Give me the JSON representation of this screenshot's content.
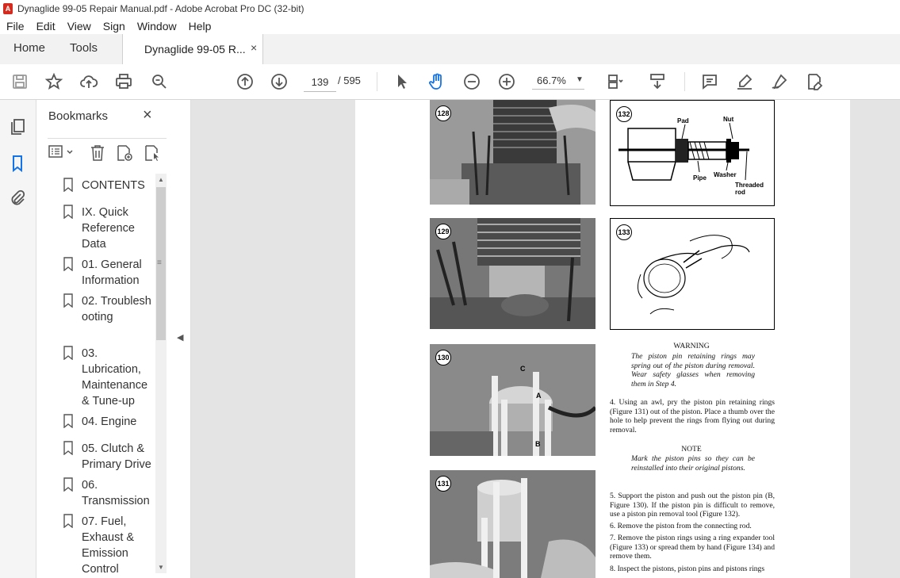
{
  "window": {
    "title": "Dynaglide 99-05 Repair Manual.pdf - Adobe Acrobat Pro DC (32-bit)",
    "app_icon_label": "A"
  },
  "menu": [
    "File",
    "Edit",
    "View",
    "Sign",
    "Window",
    "Help"
  ],
  "tabs": {
    "home": "Home",
    "tools": "Tools",
    "document": "Dynaglide 99-05 R...",
    "close": "×"
  },
  "toolbar": {
    "page_current": "139",
    "page_total": "/ 595",
    "zoom": "66.7%",
    "icons": [
      "save-icon",
      "bookmark-star-icon",
      "upload-icon",
      "print-icon",
      "search-zoom-icon",
      "page-up-icon",
      "page-down-icon",
      "select-cursor-icon",
      "hand-icon",
      "zoom-out-icon",
      "zoom-in-icon",
      "page-layout-icon",
      "scroll-mode-icon",
      "comment-icon",
      "highlight-icon",
      "sign-icon",
      "edit-pdf-icon"
    ]
  },
  "bookmarks": {
    "title": "Bookmarks",
    "close": "×",
    "items": [
      {
        "label": "CONTENTS"
      },
      {
        "label": "IX. Quick Reference Data"
      },
      {
        "label": "01. General Information"
      },
      {
        "label": "02. Troubleshooting"
      },
      {
        "label": "03. Lubrication, Maintenance & Tune-up"
      },
      {
        "label": "04. Engine"
      },
      {
        "label": "05. Clutch & Primary Drive"
      },
      {
        "label": "06. Transmission"
      },
      {
        "label": "07. Fuel, Exhaust & Emission Control"
      }
    ]
  },
  "page": {
    "figures": {
      "f128": "128",
      "f129": "129",
      "f130": "130",
      "f131": "131",
      "f132": "132",
      "f133": "133"
    },
    "fig132_labels": {
      "pad": "Pad",
      "nut": "Nut",
      "pipe": "Pipe",
      "washer": "Washer",
      "threaded_rod": "Threaded rod"
    },
    "fig130_labels": {
      "a": "A",
      "b": "B",
      "c": "C"
    },
    "warning_title": "WARNING",
    "warning_text": "The piston pin retaining rings may spring out of the piston during removal. Wear safety glasses when removing them in Step 4.",
    "step4": "4. Using an awl, pry the piston pin retaining rings (Figure 131) out of the piston. Place a thumb over the hole to help prevent the rings from flying out during removal.",
    "note_title": "NOTE",
    "note_text": "Mark the piston pins so they can be reinstalled into their original pistons.",
    "step5": "5. Support the piston and push out the piston pin (B, Figure 130). If the piston pin is difficult to remove, use a piston pin removal tool (Figure 132).",
    "step6": "6. Remove the piston from the connecting rod.",
    "step7": "7. Remove the piston rings using a ring expander tool (Figure 133) or spread them by hand (Figure 134) and remove them.",
    "step8": "8. Inspect the pistons, piston pins and pistons rings"
  }
}
